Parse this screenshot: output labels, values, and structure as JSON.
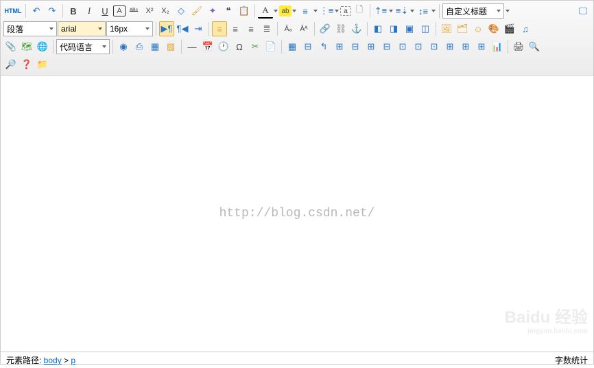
{
  "toolbar": {
    "html": "HTML",
    "paragraph": "段落",
    "font": "arial",
    "fontsize": "16px",
    "custom_heading": "自定义标题",
    "code_lang": "代码语言"
  },
  "glyphs": {
    "bold": "B",
    "italic": "I",
    "underline": "U",
    "quote": "❝",
    "sup": "X²",
    "sub": "X₂",
    "font_a": "A",
    "strike": "ᴬᴮᶜ",
    "box_a": "A",
    "omega": "Ω",
    "hr": "—"
  },
  "watermark": "http://blog.csdn.net/",
  "statusbar": {
    "path_label": "元素路径: ",
    "crumb1": "body",
    "sep": " > ",
    "crumb2": "p",
    "wordcount": "字数统计"
  },
  "baidu": {
    "main": "Baidu 经验",
    "sub": "jingyan.baidu.com"
  }
}
